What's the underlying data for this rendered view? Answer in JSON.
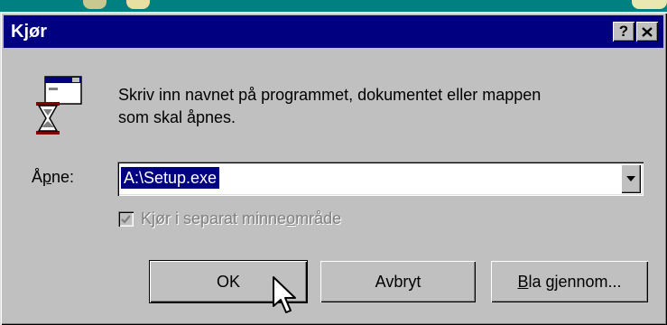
{
  "window": {
    "title": "Kjør",
    "help_button": "?",
    "close_button": "✕"
  },
  "description": {
    "line1": "Skriv inn navnet på programmet, dokumentet eller mappen",
    "line2": "som skal åpnes."
  },
  "open_field": {
    "label_pre": "Å",
    "label_accel": "p",
    "label_post": "ne:",
    "value": "A:\\Setup.exe"
  },
  "checkbox": {
    "label_pre": "Kjør i separat minne",
    "label_accel": "o",
    "label_post": "mråde",
    "checked": true,
    "enabled": false
  },
  "buttons": {
    "ok": "OK",
    "cancel": "Avbryt",
    "browse_accel": "B",
    "browse_rest": "la gjennom..."
  },
  "colors": {
    "titlebar": "#000080",
    "face": "#c0c0c0",
    "desktop": "#008080"
  },
  "icons": [
    "program-hourglass-icon",
    "dropdown-arrow-icon",
    "mouse-pointer-icon",
    "checkmark-icon"
  ]
}
